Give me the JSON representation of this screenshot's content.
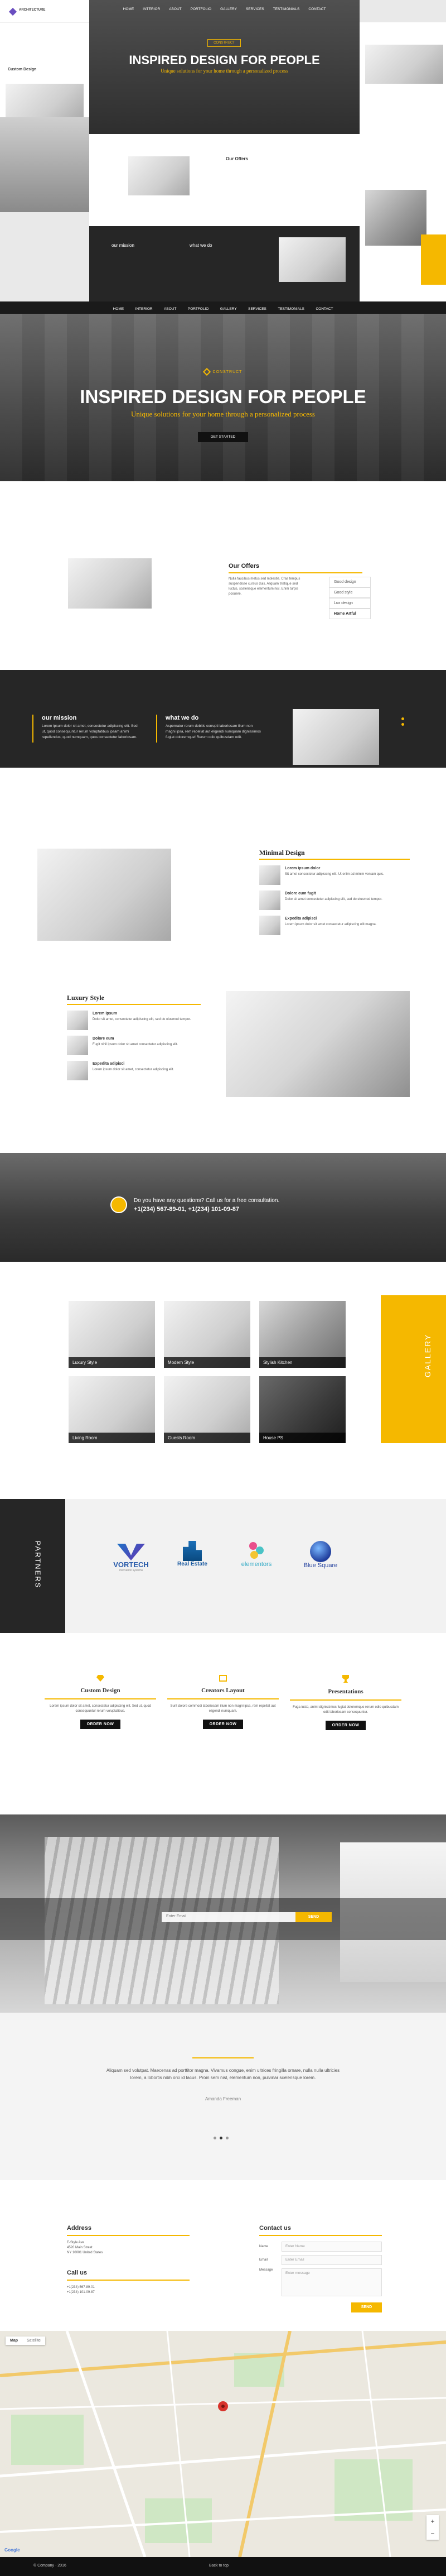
{
  "colors": {
    "accent": "#f5b800",
    "dark": "#262626",
    "footer": "#111111"
  },
  "preview": {
    "brand": "ARCHITECTURE",
    "nav": [
      "HOME",
      "INTERIOR",
      "ABOUT",
      "PORTFOLIO",
      "GALLERY",
      "SERVICES",
      "TESTIMONIALS",
      "CONTACT"
    ],
    "hero_badge": "CONSTRUCT",
    "hero_title": "INSPIRED DESIGN FOR PEOPLE",
    "hero_sub": "Unique solutions for your home through a personalized process",
    "offers_title": "Our Offers",
    "side_title": "Custom Design",
    "mission": "our mission",
    "whatwedo": "what we do"
  },
  "nav": {
    "items": [
      "HOME",
      "INTERIOR",
      "ABOUT",
      "PORTFOLIO",
      "GALLERY",
      "SERVICES",
      "TESTIMONIALS",
      "CONTACT"
    ]
  },
  "hero": {
    "badge": "CONSTRUCT",
    "title": "INSPIRED DESIGN FOR PEOPLE",
    "subtitle": "Unique solutions for your home through a personalized process",
    "button": "GET STARTED"
  },
  "offers": {
    "title": "Our Offers",
    "text": "Nulla faucibus metus sed molestie. Cras tempus suspendisse cursus duis. Aliquam tristique sed luctus, scelerisque elementum nisl. Enim turpis posuere.",
    "list": [
      "Good design",
      "Good style",
      "Lux design",
      "Home Artful"
    ]
  },
  "mission": {
    "title": "our mission",
    "text": "Lorem ipsum dolor sit amet, consectetur adipiscing elit. Sed ut, quod consequuntur rerum voluptatibus ipsam animi repellendus, quod numquam, quos consectetur laboriosam."
  },
  "whatwedo": {
    "title": "what we do",
    "text": "Aspernatur rerum debitis corrupti laboriosam illum non magni ipsa, rem repellat aut eligendi numquam dignissimos fugiat doloremque! Rerum odio quibusdam odit."
  },
  "minimal": {
    "title": "Minimal Design",
    "items": [
      {
        "t": "Lorem ipsum dolor",
        "d": "Sit amet consectetur adipiscing elit. Ut enim ad minim veniam quis."
      },
      {
        "t": "Dolore eum fugit",
        "d": "Dolor sit amet consectetur adipiscing elit, sed do eiusmod tempor."
      },
      {
        "t": "Expedita adipisci",
        "d": "Lorem ipsum dolor sit amet consectetur adipiscing elit magna."
      }
    ]
  },
  "luxury": {
    "title": "Luxury Style",
    "items": [
      {
        "t": "Lorem ipsum",
        "d": "Dolor sit amet, consectetur adipiscing elit, sed do eiusmod tempor."
      },
      {
        "t": "Dolore eum",
        "d": "Fugit nihil ipsum dolor sit amet consectetur adipiscing elit."
      },
      {
        "t": "Expedita adipisci",
        "d": "Lorem ipsum dolor sit amet, consectetur adipiscing elit."
      }
    ]
  },
  "cta": {
    "question": "Do you have any questions? Call us for a free consultation.",
    "phones": "+1(234) 567-89-01, +1(234) 101-09-87"
  },
  "gallery": {
    "label": "GALLERY",
    "items": [
      "Luxury Style",
      "Modern Style",
      "Stylish Kitchen",
      "Living Room",
      "Guests Room",
      "House PS"
    ]
  },
  "partners": {
    "label": "PARTNERS",
    "logos": [
      {
        "name": "VORTECH",
        "sub": "innovation systems"
      },
      {
        "name": "Real Estate",
        "sub": ""
      },
      {
        "name": "elementors",
        "sub": ""
      },
      {
        "name": "Blue Square",
        "sub": ""
      }
    ]
  },
  "services": [
    {
      "title": "Custom Design",
      "text": "Lorem ipsum dolor sit amet, consectetur adipiscing elit. Sed ut, quod consequuntur rerum voluptatibus.",
      "button": "ORDER NOW"
    },
    {
      "title": "Creators Layout",
      "text": "Sunt dolore commodi laboriosam illum non magni ipsa, rem repellat aut eligendi numquam.",
      "button": "ORDER NOW"
    },
    {
      "title": "Presentations",
      "text": "Fuga iusto, animi dignissimos fugiat doloremque rerum odio quibusdam odit laboriosam consequuntur.",
      "button": "ORDER NOW"
    }
  ],
  "subscribe": {
    "placeholder": "Enter Email",
    "button": "SEND"
  },
  "testimonial": {
    "quote": "Aliquam sed volutpat. Maecenas ad porttitor magna. Vivamus congue, enim ultrices fringilla ornare, nulla nulla ultricies lorem, a lobortis nibh orci id lacus. Proin sem nisl, elementum non, pulvinar scelerisque lorem.",
    "author": "Amanda Freeman"
  },
  "address": {
    "title": "Address",
    "lines": [
      "E-Style Ave",
      "4520 Main Street",
      "NY 10001 United States"
    ],
    "call_title": "Call us",
    "phones": [
      "+1(234) 567-89-01",
      "+1(234) 101-09-87"
    ]
  },
  "contact": {
    "title": "Contact us",
    "fields": [
      {
        "label": "Name",
        "placeholder": "Enter Name"
      },
      {
        "label": "Email",
        "placeholder": "Enter Email"
      },
      {
        "label": "Message",
        "placeholder": "Enter message"
      }
    ],
    "button": "SEND"
  },
  "map": {
    "label": "Map",
    "satellite": "Satellite",
    "google": "Google"
  },
  "footer": {
    "copyright": "© Company · 2016",
    "back": "Back to top"
  }
}
